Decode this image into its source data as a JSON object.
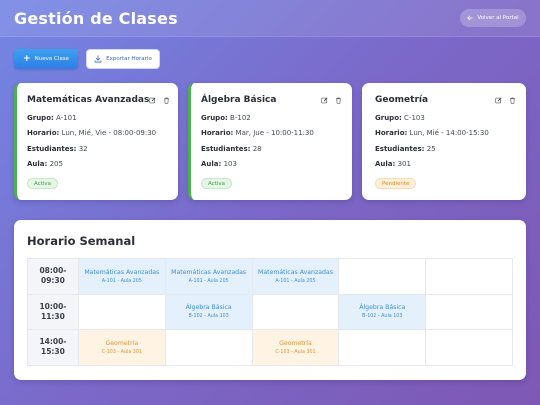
{
  "header": {
    "title": "Gestión de Clases",
    "back_label": "Volver al Portal"
  },
  "actions": {
    "new_class_label": "Nueva Clase",
    "export_label": "Exportar Horario"
  },
  "cards": [
    {
      "name": "Matemáticas Avanzadas",
      "grupo_label": "Grupo:",
      "grupo": "A-101",
      "horario_label": "Horario:",
      "horario": "Lun, Mié, Vie - 08:00-09:30",
      "estudiantes_label": "Estudiantes:",
      "estudiantes": "32",
      "aula_label": "Aula:",
      "aula": "205",
      "status": "Activa"
    },
    {
      "name": "Álgebra Básica",
      "grupo_label": "Grupo:",
      "grupo": "B-102",
      "horario_label": "Horario:",
      "horario": "Mar, Jue - 10:00-11:30",
      "estudiantes_label": "Estudiantes:",
      "estudiantes": "28",
      "aula_label": "Aula:",
      "aula": "103",
      "status": "Activa"
    },
    {
      "name": "Geometría",
      "grupo_label": "Grupo:",
      "grupo": "C-103",
      "horario_label": "Horario:",
      "horario": "Lun, Mié - 14:00-15:30",
      "estudiantes_label": "Estudiantes:",
      "estudiantes": "25",
      "aula_label": "Aula:",
      "aula": "301",
      "status": "Pendiente"
    }
  ],
  "schedule": {
    "title": "Horario Semanal",
    "rows": [
      {
        "time_start": "08:00-",
        "time_end": "09:30",
        "slots": [
          {
            "name": "Matemáticas Avanzadas",
            "sub": "A-101 - Aula 205",
            "color": "blue"
          },
          {
            "name": "Matemáticas Avanzadas",
            "sub": "A-101 - Aula 205",
            "color": "blue"
          },
          {
            "name": "Matemáticas Avanzadas",
            "sub": "A-101 - Aula 205",
            "color": "blue"
          },
          {
            "name": "",
            "sub": "",
            "color": "empty"
          },
          {
            "name": "",
            "sub": "",
            "color": "empty"
          }
        ]
      },
      {
        "time_start": "10:00-",
        "time_end": "11:30",
        "slots": [
          {
            "name": "",
            "sub": "",
            "color": "empty"
          },
          {
            "name": "Álgebra Básica",
            "sub": "B-102 - Aula 103",
            "color": "blue"
          },
          {
            "name": "",
            "sub": "",
            "color": "empty"
          },
          {
            "name": "Álgebra Básica",
            "sub": "B-102 - Aula 103",
            "color": "blue"
          },
          {
            "name": "",
            "sub": "",
            "color": "empty"
          }
        ]
      },
      {
        "time_start": "14:00-",
        "time_end": "15:30",
        "slots": [
          {
            "name": "Geometría",
            "sub": "C-103 - Aula 301",
            "color": "orange"
          },
          {
            "name": "",
            "sub": "",
            "color": "empty"
          },
          {
            "name": "Geometría",
            "sub": "C-103 - Aula 301",
            "color": "orange"
          },
          {
            "name": "",
            "sub": "",
            "color": "empty"
          },
          {
            "name": "",
            "sub": "",
            "color": "empty"
          }
        ]
      }
    ]
  },
  "colors": {
    "accent": "#2f7ee6",
    "active_badge": "#3d9a43",
    "pending_badge": "#e08a1c",
    "slot_blue": "#e4f1fc",
    "slot_orange": "#fff3e3"
  },
  "icons": {
    "back": "arrow-left-icon",
    "new": "plus-icon",
    "export": "download-icon",
    "edit": "edit-icon",
    "delete": "trash-icon"
  }
}
